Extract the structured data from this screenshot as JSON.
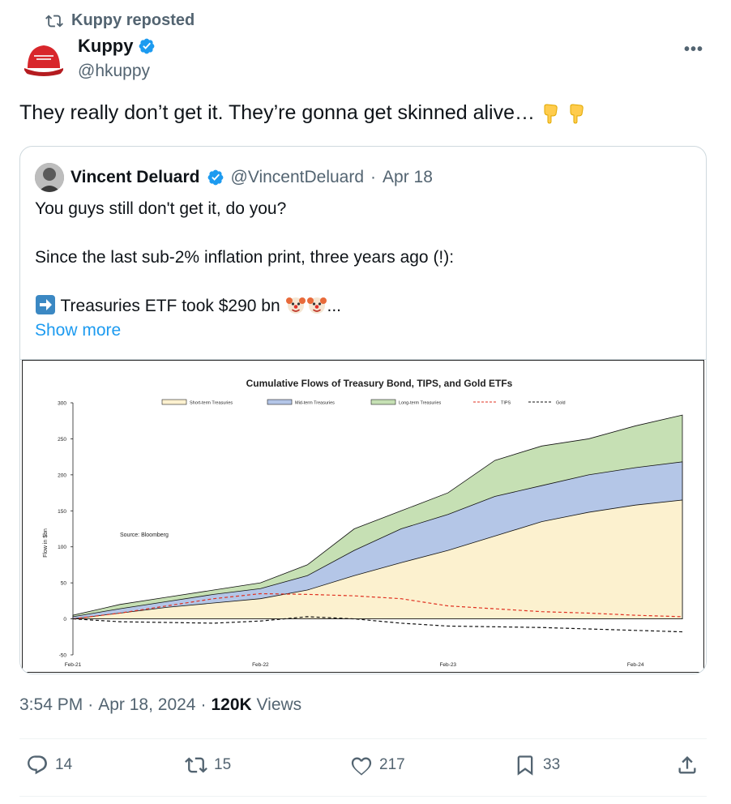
{
  "repost": {
    "label": "Kuppy reposted"
  },
  "author": {
    "name": "Kuppy",
    "handle": "@hkuppy"
  },
  "tweet": {
    "text": "They really don’t get it. They’re gonna get skinned alive…"
  },
  "quote": {
    "name": "Vincent Deluard",
    "handle": "@VincentDeluard",
    "sep": "·",
    "date": "Apr 18",
    "lines": [
      "You guys still don't get it, do you?",
      "Since the last sub-2% inflation print, three years ago (!):",
      "Treasuries ETF took $290 bn"
    ],
    "ellipsis": "...",
    "show_more": "Show more"
  },
  "meta": {
    "time": "3:54 PM",
    "date": "Apr 18, 2024",
    "views_count": "120K",
    "views_label": "Views",
    "sep": "·"
  },
  "actions": {
    "replies": "14",
    "reposts": "15",
    "likes": "217",
    "bookmarks": "33"
  },
  "colors": {
    "short_term": "#fcf1cf",
    "mid_term": "#b4c6e7",
    "long_term": "#c6e0b4",
    "tips": "#e03020",
    "gold": "#111111",
    "accent": "#1d9bf0"
  },
  "chart_data": {
    "type": "area",
    "title": "Cumulative Flows of Treasury Bond, TIPS, and Gold ETFs",
    "ylabel": "Flow in $bn",
    "annotation": "Source: Bloomberg",
    "ylim": [
      -50,
      300
    ],
    "yticks": [
      "300",
      "250",
      "200",
      "150",
      "100",
      "50",
      "0",
      "-50"
    ],
    "xticks": [
      "Feb-21",
      "Feb-22",
      "Feb-23",
      "Feb-24"
    ],
    "x": [
      "Feb-21",
      "May-21",
      "Aug-21",
      "Nov-21",
      "Feb-22",
      "May-22",
      "Aug-22",
      "Nov-22",
      "Feb-23",
      "May-23",
      "Aug-23",
      "Nov-23",
      "Feb-24",
      "Apr-24"
    ],
    "series": [
      {
        "name": "Short-term Treasuries",
        "values": [
          0,
          8,
          16,
          22,
          28,
          40,
          60,
          78,
          95,
          115,
          135,
          148,
          158,
          165
        ]
      },
      {
        "name": "Mid-term Treasuries",
        "values": [
          3,
          14,
          24,
          34,
          42,
          60,
          95,
          125,
          145,
          170,
          185,
          200,
          210,
          218
        ]
      },
      {
        "name": "Long-term Treasuries",
        "values": [
          5,
          20,
          30,
          40,
          50,
          75,
          125,
          150,
          175,
          220,
          240,
          250,
          268,
          283
        ]
      },
      {
        "name": "TIPS",
        "values": [
          0,
          8,
          18,
          28,
          35,
          34,
          32,
          28,
          18,
          14,
          10,
          8,
          5,
          3
        ]
      },
      {
        "name": "Gold",
        "values": [
          0,
          -4,
          -5,
          -6,
          -3,
          3,
          0,
          -6,
          -10,
          -11,
          -12,
          -14,
          -16,
          -18
        ]
      }
    ]
  }
}
